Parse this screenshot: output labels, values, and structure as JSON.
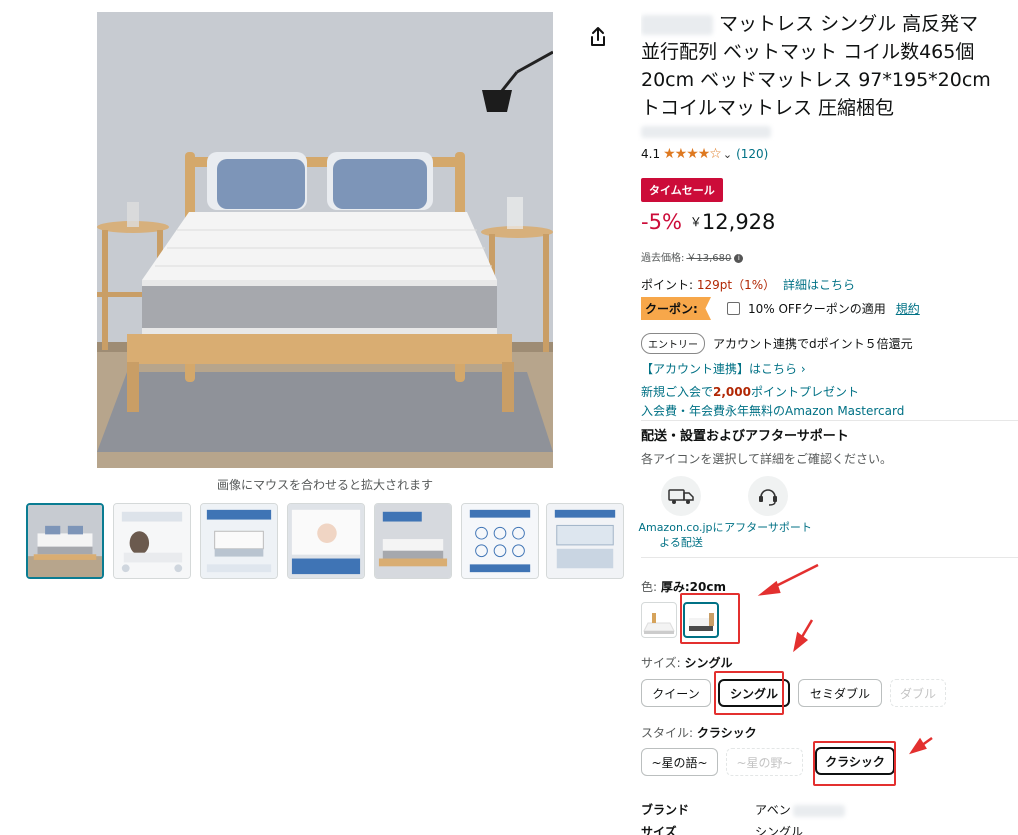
{
  "title_lines": [
    "マットレス シングル 高反発マ",
    "並行配列 ベットマット コイル数465個",
    "20cm ベッドマットレス 97*195*20cm",
    "トコイルマットレス 圧縮梱包"
  ],
  "zoom_hint": "画像にマウスを合わせると拡大されます",
  "rating": {
    "value": "4.1",
    "stars": "★★★★☆",
    "count": "(120)"
  },
  "deal_badge": "タイムセール",
  "price": {
    "discount": "-5%",
    "currency": "￥",
    "amount": "12,928"
  },
  "past_price": {
    "label": "過去価格:",
    "value": "￥13,680"
  },
  "points": {
    "label": "ポイント:",
    "value": "129pt（1%）",
    "link": "詳細はこちら"
  },
  "coupon": {
    "tag": "クーポン:",
    "text": "10% OFFクーポンの適用",
    "terms": "規約"
  },
  "entry": {
    "button": "エントリー",
    "text": "アカウント連携でdポイント５倍還元"
  },
  "account_link": "【アカウント連携】はこちら ›",
  "promo": {
    "line1_pre": "新規ご入会で",
    "line1_bold": "2,000",
    "line1_post": "ポイントプレゼント",
    "line2": "入会費・年会費永年無料のAmazon Mastercard"
  },
  "delivery": {
    "title": "配送・設置およびアフターサポート",
    "subtitle": "各アイコンを選択して詳細をご確認ください。",
    "services": [
      {
        "label": "Amazon.co.jpによる配送",
        "icon": "delivery-truck-icon"
      },
      {
        "label": "アフターサポート",
        "icon": "headset-support-icon"
      }
    ]
  },
  "color_label": {
    "prefix": "色: ",
    "value": "厚み:20cm"
  },
  "size_label": {
    "prefix": "サイズ: ",
    "value": "シングル"
  },
  "size_options": [
    {
      "label": "クイーン",
      "state": "normal"
    },
    {
      "label": "シングル",
      "state": "selected"
    },
    {
      "label": "セミダブル",
      "state": "normal"
    },
    {
      "label": "ダブル",
      "state": "disabled"
    }
  ],
  "style_label": {
    "prefix": "スタイル: ",
    "value": "クラシック"
  },
  "style_options": [
    {
      "label": "~星の語~",
      "state": "normal"
    },
    {
      "label": "~星の野~",
      "state": "disabled"
    },
    {
      "label": "クラシック",
      "state": "selected"
    }
  ],
  "specs": [
    {
      "key": "ブランド",
      "value": "アベン"
    },
    {
      "key": "サイズ",
      "value": "シングル"
    }
  ],
  "colors": {
    "link": "#007185",
    "price_red": "#cc0c39",
    "annotation_red": "#e3302f",
    "star": "#de7921",
    "coupon": "#f7a74a"
  }
}
